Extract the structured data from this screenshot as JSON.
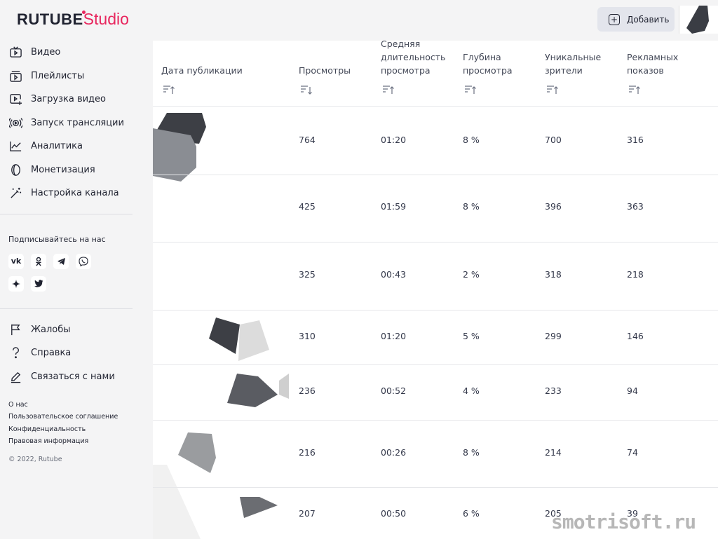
{
  "header": {
    "logo_brand": "RUTUBE",
    "logo_product": "Studio",
    "add_button_label": "Добавить"
  },
  "sidebar": {
    "nav": [
      {
        "label": "Видео",
        "icon": "tv-icon"
      },
      {
        "label": "Плейлисты",
        "icon": "playlist-icon"
      },
      {
        "label": "Загрузка видео",
        "icon": "upload-video-icon"
      },
      {
        "label": "Запуск трансляции",
        "icon": "broadcast-icon"
      },
      {
        "label": "Аналитика",
        "icon": "analytics-icon"
      },
      {
        "label": "Монетизация",
        "icon": "coin-icon"
      },
      {
        "label": "Настройка канала",
        "icon": "magic-wand-icon"
      }
    ],
    "social_title": "Подписывайтесь на нас",
    "social": [
      {
        "label": "vk",
        "icon": "vk-icon"
      },
      {
        "label": "ok",
        "icon": "odnoklassniki-icon"
      },
      {
        "label": "tg",
        "icon": "telegram-icon"
      },
      {
        "label": "viber",
        "icon": "viber-icon"
      },
      {
        "label": "zen",
        "icon": "zen-icon"
      },
      {
        "label": "tw",
        "icon": "twitter-icon"
      }
    ],
    "support": [
      {
        "label": "Жалобы",
        "icon": "flag-icon"
      },
      {
        "label": "Справка",
        "icon": "question-icon"
      },
      {
        "label": "Связаться с нами",
        "icon": "pencil-icon"
      }
    ],
    "footer_links": [
      "О нас",
      "Пользовательское соглашение",
      "Конфиденциальность",
      "Правовая информация"
    ],
    "copyright": "© 2022, Rutube"
  },
  "table": {
    "columns": [
      {
        "label": "Дата публикации",
        "sort": "asc"
      },
      {
        "label": "Просмотры",
        "sort": "desc"
      },
      {
        "label": "Средняя длительность просмотра",
        "sort": "asc"
      },
      {
        "label": "Глубина просмотра",
        "sort": "asc"
      },
      {
        "label": "Уникальные зрители",
        "sort": "asc"
      },
      {
        "label": "Рекламных показов",
        "sort": "asc"
      }
    ],
    "rows": [
      {
        "views": "764",
        "avg_duration": "01:20",
        "depth": "8 %",
        "unique": "700",
        "ads": "316"
      },
      {
        "views": "425",
        "avg_duration": "01:59",
        "depth": "8 %",
        "unique": "396",
        "ads": "363"
      },
      {
        "views": "325",
        "avg_duration": "00:43",
        "depth": "2 %",
        "unique": "318",
        "ads": "218"
      },
      {
        "views": "310",
        "avg_duration": "01:20",
        "depth": "5 %",
        "unique": "299",
        "ads": "146"
      },
      {
        "views": "236",
        "avg_duration": "00:52",
        "depth": "4 %",
        "unique": "233",
        "ads": "94"
      },
      {
        "views": "216",
        "avg_duration": "00:26",
        "depth": "8 %",
        "unique": "214",
        "ads": "74"
      },
      {
        "views": "207",
        "avg_duration": "00:50",
        "depth": "6 %",
        "unique": "205",
        "ads": "39"
      }
    ]
  },
  "watermark": "smotrisoft.ru",
  "colors": {
    "accent": "#e8265e",
    "text": "#1f2230",
    "sidebar_bg": "#f4f4f5"
  }
}
